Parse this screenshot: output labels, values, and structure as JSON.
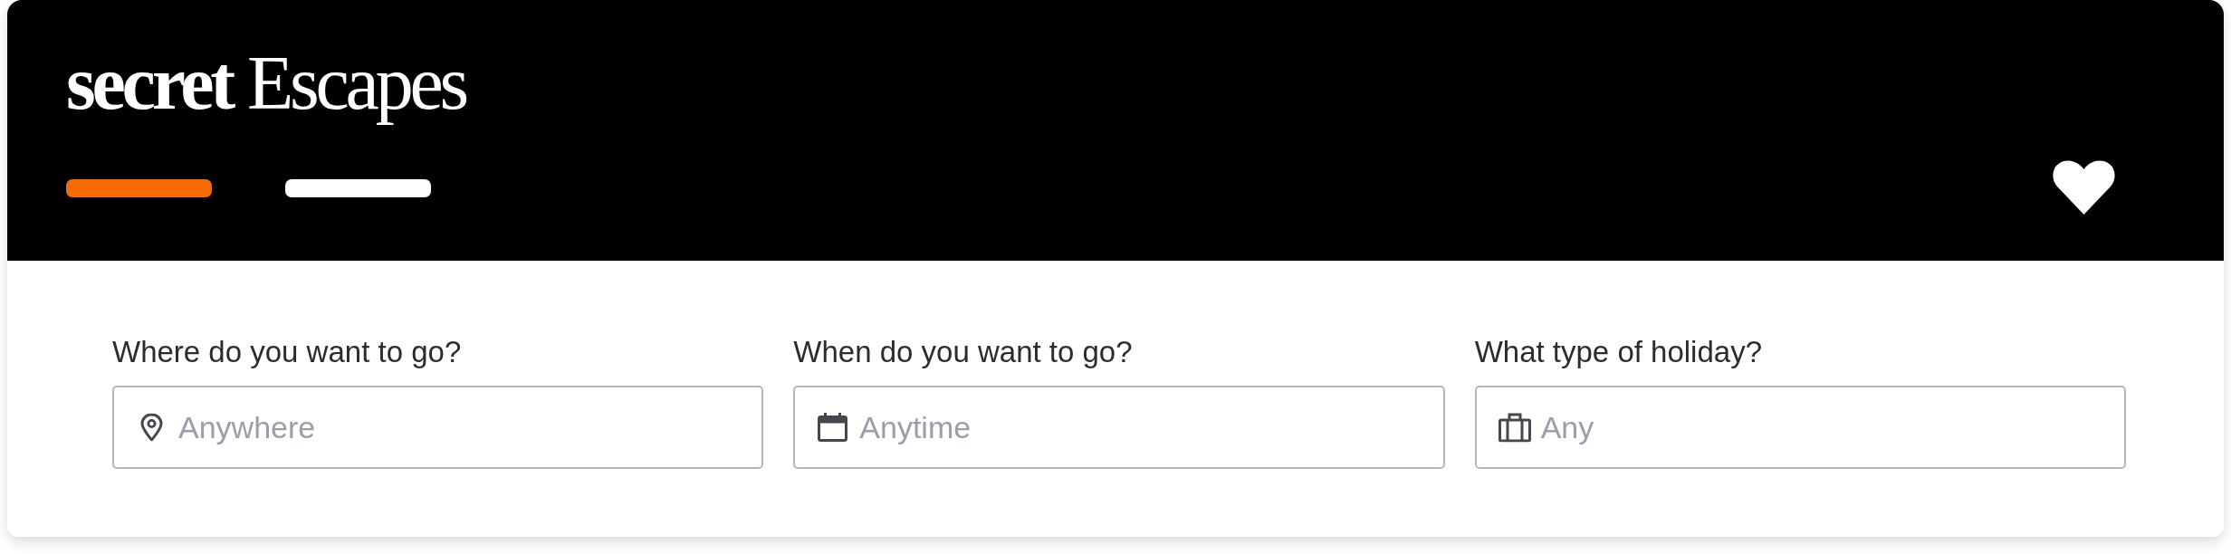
{
  "header": {
    "logo": "**secret** Escapes",
    "slides": [
      {
        "selected": true
      },
      {
        "selected": false
      }
    ]
  },
  "search": {
    "fields": [
      {
        "kind": "destination",
        "label": "Where do you want to go?",
        "placeholder": "Anywhere"
      },
      {
        "kind": "dates",
        "label": "When do you want to go?",
        "placeholder": "Anytime"
      },
      {
        "kind": "holiday_type",
        "label": "What type of holiday?",
        "placeholder": "Any"
      }
    ]
  }
}
